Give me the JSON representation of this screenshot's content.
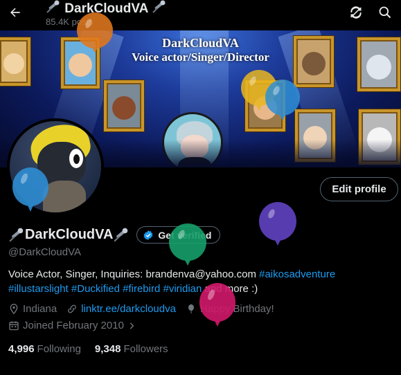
{
  "header": {
    "title": "DarkCloudVA",
    "posts": "85.4K posts",
    "back_icon": "arrow-left-icon",
    "refresh_icon": "refresh-icon",
    "search_icon": "search-icon"
  },
  "banner": {
    "title_line1": "DarkCloudVA",
    "title_line2": "Voice actor/Singer/Director",
    "frame_colors": [
      "#c9962a"
    ]
  },
  "profile": {
    "edit_label": "Edit profile",
    "display_name": "DarkCloudVA",
    "verify_label": "Get verified",
    "handle": "@DarkCloudVA",
    "bio_text": "Voice Actor, Singer,  Inquiries: brandenva@yahoo.com ",
    "bio_tags": [
      "#aikosadventure",
      "#illustarslight",
      "#Duckified",
      "#firebird",
      "#viridian"
    ],
    "bio_tail": " and more :)",
    "location": "Indiana",
    "link": "linktr.ee/darkcloudva",
    "birthday": "Happy Birthday!",
    "joined": "Joined February 2010",
    "following_count": "4,996",
    "following_label": "Following",
    "followers_count": "9,348",
    "followers_label": "Followers"
  },
  "colors": {
    "accent": "#1d9bf0",
    "muted": "#71767b",
    "balloon_orange": "#e0781e",
    "balloon_blue": "#2f8fd6",
    "balloon_yellow": "#e9b620",
    "balloon_green": "#16a06a",
    "balloon_purple": "#5b3fb8",
    "balloon_pink": "#d1186a"
  }
}
